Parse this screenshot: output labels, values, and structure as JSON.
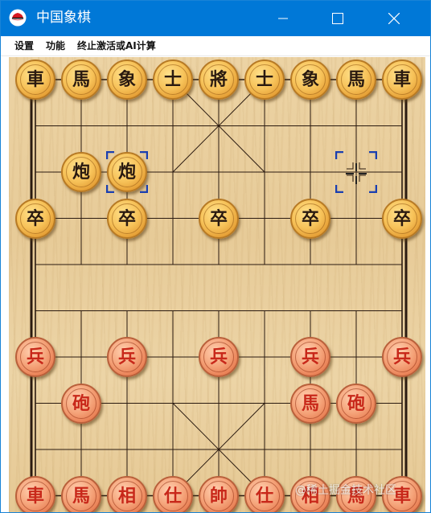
{
  "window": {
    "title": "中国象棋",
    "icon": "red-hat-icon"
  },
  "menu": [
    {
      "label": "设置"
    },
    {
      "label": "功能"
    },
    {
      "label": "终止激活或AI计算"
    }
  ],
  "board": {
    "files": 9,
    "ranks": 10,
    "river_text": ""
  },
  "pieces": [
    {
      "side": "black",
      "char": "車",
      "file": 0,
      "rank": 0
    },
    {
      "side": "black",
      "char": "馬",
      "file": 1,
      "rank": 0
    },
    {
      "side": "black",
      "char": "象",
      "file": 2,
      "rank": 0
    },
    {
      "side": "black",
      "char": "士",
      "file": 3,
      "rank": 0
    },
    {
      "side": "black",
      "char": "將",
      "file": 4,
      "rank": 0
    },
    {
      "side": "black",
      "char": "士",
      "file": 5,
      "rank": 0
    },
    {
      "side": "black",
      "char": "象",
      "file": 6,
      "rank": 0
    },
    {
      "side": "black",
      "char": "馬",
      "file": 7,
      "rank": 0
    },
    {
      "side": "black",
      "char": "車",
      "file": 8,
      "rank": 0
    },
    {
      "side": "black",
      "char": "炮",
      "file": 1,
      "rank": 2
    },
    {
      "side": "black",
      "char": "炮",
      "file": 2,
      "rank": 2
    },
    {
      "side": "black",
      "char": "卒",
      "file": 0,
      "rank": 3
    },
    {
      "side": "black",
      "char": "卒",
      "file": 2,
      "rank": 3
    },
    {
      "side": "black",
      "char": "卒",
      "file": 4,
      "rank": 3
    },
    {
      "side": "black",
      "char": "卒",
      "file": 6,
      "rank": 3
    },
    {
      "side": "black",
      "char": "卒",
      "file": 8,
      "rank": 3
    },
    {
      "side": "red",
      "char": "兵",
      "file": 0,
      "rank": 6
    },
    {
      "side": "red",
      "char": "兵",
      "file": 2,
      "rank": 6
    },
    {
      "side": "red",
      "char": "兵",
      "file": 4,
      "rank": 6
    },
    {
      "side": "red",
      "char": "兵",
      "file": 6,
      "rank": 6
    },
    {
      "side": "red",
      "char": "兵",
      "file": 8,
      "rank": 6
    },
    {
      "side": "red",
      "char": "砲",
      "file": 1,
      "rank": 7
    },
    {
      "side": "red",
      "char": "馬",
      "file": 6,
      "rank": 7
    },
    {
      "side": "red",
      "char": "砲",
      "file": 7,
      "rank": 7
    },
    {
      "side": "red",
      "char": "車",
      "file": 0,
      "rank": 9
    },
    {
      "side": "red",
      "char": "馬",
      "file": 1,
      "rank": 9
    },
    {
      "side": "red",
      "char": "相",
      "file": 2,
      "rank": 9
    },
    {
      "side": "red",
      "char": "仕",
      "file": 3,
      "rank": 9
    },
    {
      "side": "red",
      "char": "帥",
      "file": 4,
      "rank": 9
    },
    {
      "side": "red",
      "char": "仕",
      "file": 5,
      "rank": 9
    },
    {
      "side": "red",
      "char": "相",
      "file": 6,
      "rank": 9
    },
    {
      "side": "red",
      "char": "馬",
      "file": 7,
      "rank": 9
    },
    {
      "side": "red",
      "char": "車",
      "file": 8,
      "rank": 9
    }
  ],
  "selection": [
    {
      "file": 2,
      "rank": 2
    },
    {
      "file": 7,
      "rank": 2
    }
  ],
  "colors": {
    "titlebar": "#0078d7",
    "board_line": "#2a1a10",
    "selection": "#1a3fb0"
  },
  "watermark": "@稀土掘金技术社区"
}
